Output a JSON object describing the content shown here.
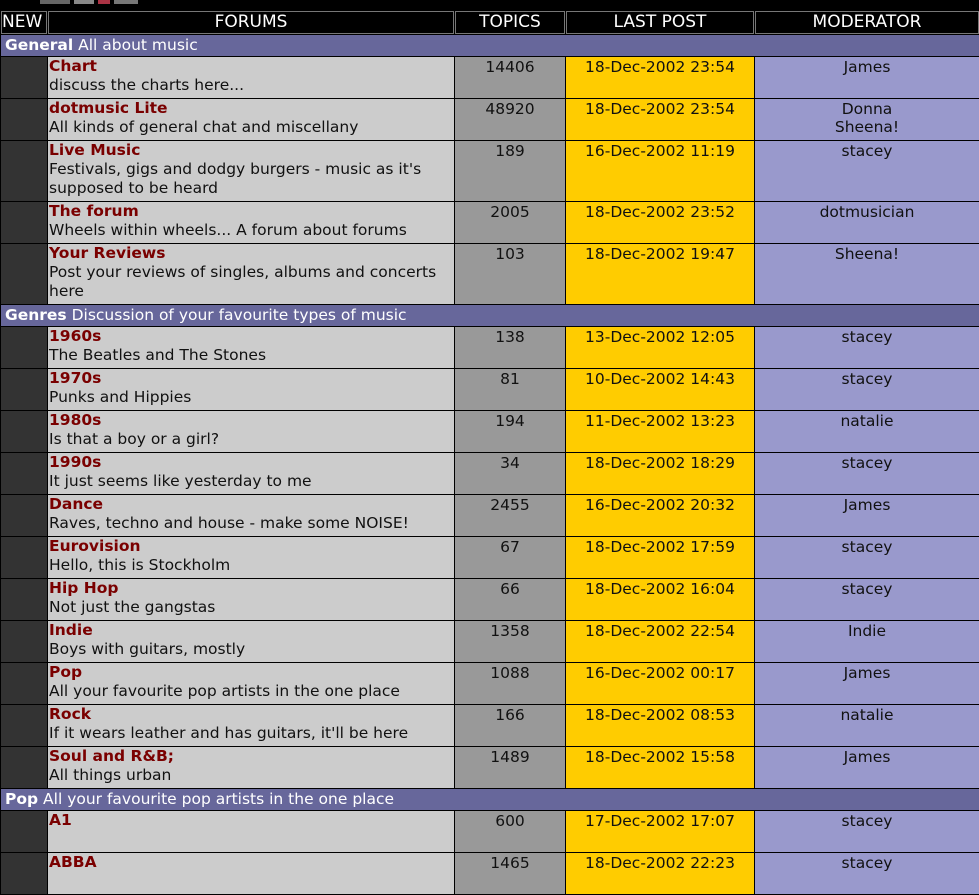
{
  "headers": {
    "new": "NEW",
    "forums": "FORUMS",
    "topics": "TOPICS",
    "last_post": "LAST POST",
    "moderator": "MODERATOR"
  },
  "categories": [
    {
      "name": "General",
      "desc": "All about music"
    },
    {
      "name": "Genres",
      "desc": "Discussion of your favourite types of music"
    },
    {
      "name": "Pop",
      "desc": "All your favourite pop artists in the one place"
    }
  ],
  "forums": [
    {
      "title": "Chart",
      "desc": "discuss the charts here...",
      "topics": "14406",
      "last_post": "18-Dec-2002 23:54",
      "mod1": "James",
      "mod2": ""
    },
    {
      "title": "dotmusic Lite",
      "desc": "All kinds of general chat and miscellany",
      "topics": "48920",
      "last_post": "18-Dec-2002 23:54",
      "mod1": "Donna",
      "mod2": "Sheena!"
    },
    {
      "title": "Live Music",
      "desc": "Festivals, gigs and dodgy burgers - music as it's supposed to be heard",
      "topics": "189",
      "last_post": "16-Dec-2002 11:19",
      "mod1": "stacey",
      "mod2": ""
    },
    {
      "title": "The forum",
      "desc": "Wheels within wheels... A forum about forums",
      "topics": "2005",
      "last_post": "18-Dec-2002 23:52",
      "mod1": "dotmusician",
      "mod2": ""
    },
    {
      "title": "Your Reviews",
      "desc": "Post your reviews of singles, albums and concerts here",
      "topics": "103",
      "last_post": "18-Dec-2002 19:47",
      "mod1": "Sheena!",
      "mod2": ""
    },
    {
      "title": "1960s",
      "desc": "The Beatles and The Stones",
      "topics": "138",
      "last_post": "13-Dec-2002 12:05",
      "mod1": "stacey",
      "mod2": ""
    },
    {
      "title": "1970s",
      "desc": "Punks and Hippies",
      "topics": "81",
      "last_post": "10-Dec-2002 14:43",
      "mod1": "stacey",
      "mod2": ""
    },
    {
      "title": "1980s",
      "desc": "Is that a boy or a girl?",
      "topics": "194",
      "last_post": "11-Dec-2002 13:23",
      "mod1": "natalie",
      "mod2": ""
    },
    {
      "title": "1990s",
      "desc": "It just seems like yesterday to me",
      "topics": "34",
      "last_post": "18-Dec-2002 18:29",
      "mod1": "stacey",
      "mod2": ""
    },
    {
      "title": "Dance",
      "desc": "Raves, techno and house - make some NOISE!",
      "topics": "2455",
      "last_post": "16-Dec-2002 20:32",
      "mod1": "James",
      "mod2": ""
    },
    {
      "title": "Eurovision",
      "desc": "Hello, this is Stockholm",
      "topics": "67",
      "last_post": "18-Dec-2002 17:59",
      "mod1": "stacey",
      "mod2": ""
    },
    {
      "title": "Hip Hop",
      "desc": "Not just the gangstas",
      "topics": "66",
      "last_post": "18-Dec-2002 16:04",
      "mod1": "stacey",
      "mod2": ""
    },
    {
      "title": "Indie",
      "desc": "Boys with guitars, mostly",
      "topics": "1358",
      "last_post": "18-Dec-2002 22:54",
      "mod1": "Indie",
      "mod2": ""
    },
    {
      "title": "Pop",
      "desc": "All your favourite pop artists in the one place",
      "topics": "1088",
      "last_post": "16-Dec-2002 00:17",
      "mod1": "James",
      "mod2": ""
    },
    {
      "title": "Rock",
      "desc": "If it wears leather and has guitars, it'll be here",
      "topics": "166",
      "last_post": "18-Dec-2002 08:53",
      "mod1": "natalie",
      "mod2": ""
    },
    {
      "title": "Soul and R&B;",
      "desc": "All things urban",
      "topics": "1489",
      "last_post": "18-Dec-2002 15:58",
      "mod1": "James",
      "mod2": ""
    },
    {
      "title": "A1",
      "desc": "",
      "topics": "600",
      "last_post": "17-Dec-2002 17:07",
      "mod1": "stacey",
      "mod2": ""
    },
    {
      "title": "ABBA",
      "desc": "",
      "topics": "1465",
      "last_post": "18-Dec-2002 22:23",
      "mod1": "stacey",
      "mod2": ""
    }
  ],
  "colors": {
    "category_bar": "#67679b",
    "forum_cell": "#cccccc",
    "topics_cell": "#999999",
    "last_post_cell": "#ffcc00",
    "moderator_cell": "#9999cc",
    "new_cell": "#333333",
    "forum_link": "#7a0000"
  }
}
